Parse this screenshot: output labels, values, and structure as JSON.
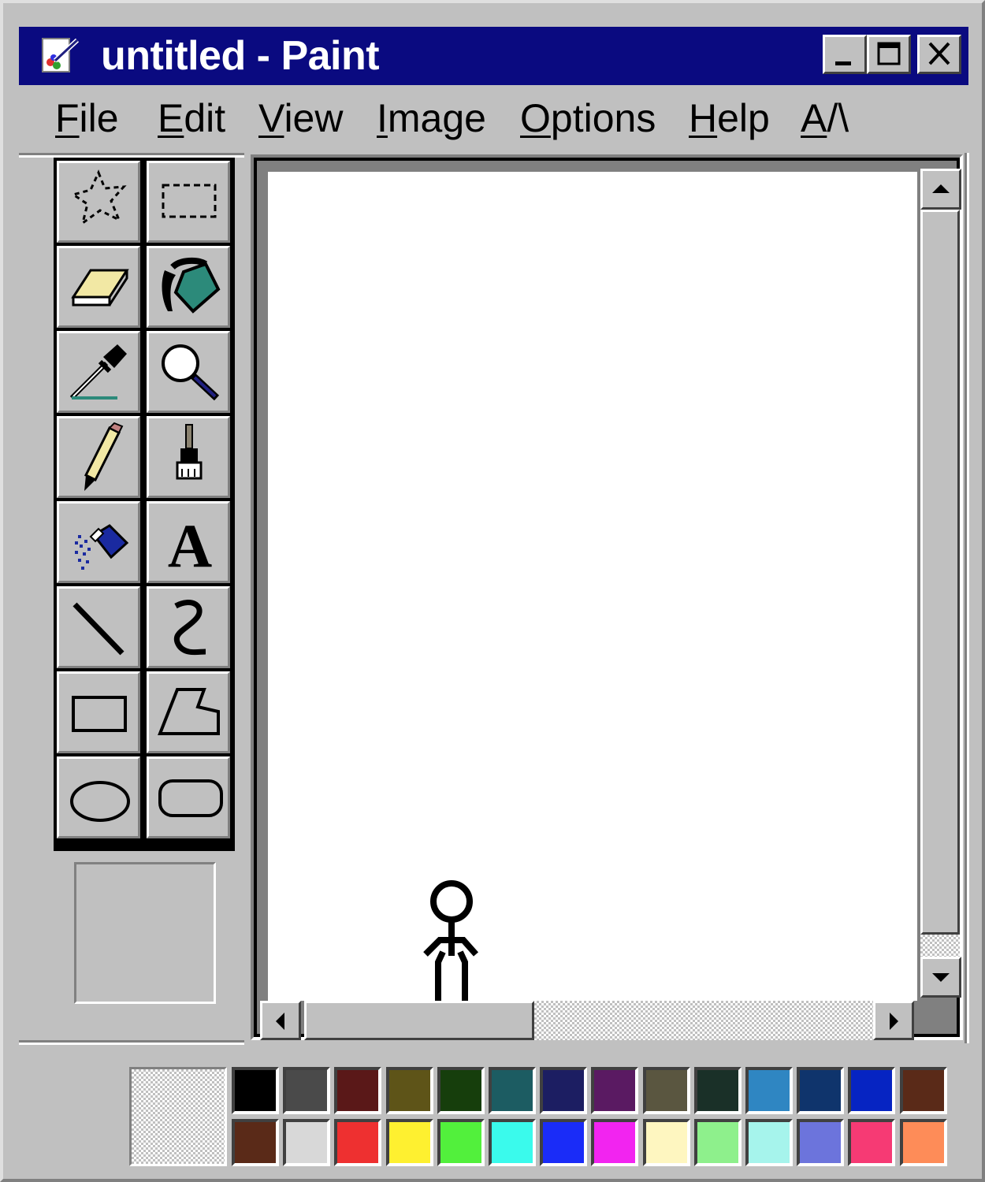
{
  "window": {
    "title": "untitled - Paint",
    "buttons": {
      "minimize": "minimize",
      "maximize": "maximize",
      "close": "close"
    }
  },
  "menu": [
    {
      "label": "File",
      "ul": "F",
      "rest": "ile"
    },
    {
      "label": "Edit",
      "ul": "E",
      "rest": "dit"
    },
    {
      "label": "View",
      "ul": "V",
      "rest": "iew"
    },
    {
      "label": "Image",
      "ul": "I",
      "rest": "mage"
    },
    {
      "label": "Options",
      "ul": "O",
      "rest": "ptions"
    },
    {
      "label": "Help",
      "ul": "H",
      "rest": "elp"
    },
    {
      "label": "A/\\",
      "ul": "A",
      "rest": "/\\"
    }
  ],
  "tools": [
    "free-form-select-icon",
    "rectangle-select-icon",
    "eraser-icon",
    "fill-bucket-icon",
    "eyedropper-icon",
    "magnifier-icon",
    "pencil-icon",
    "brush-icon",
    "airbrush-icon",
    "text-icon",
    "line-icon",
    "curve-icon",
    "rectangle-icon",
    "polygon-icon",
    "ellipse-icon",
    "rounded-rectangle-icon"
  ],
  "text_tool_glyph": "A",
  "palette": {
    "row1": [
      "#000000",
      "#4a4a4a",
      "#5a1818",
      "#5e5418",
      "#163e0c",
      "#1c5c62",
      "#1c1e62",
      "#5a1a62",
      "#5a5640",
      "#1a3028",
      "#2f86c2",
      "#0f346c",
      "#0624c2",
      "#5a2a18"
    ],
    "row2": [
      "#5a2a18",
      "#d8d8d8",
      "#ee3030",
      "#fef030",
      "#52f03c",
      "#3afaec",
      "#1a2cf8",
      "#f224f0",
      "#fef6c0",
      "#8ef08c",
      "#a6f4ec",
      "#6c74dc",
      "#f63a74",
      "#fe8c58"
    ]
  }
}
